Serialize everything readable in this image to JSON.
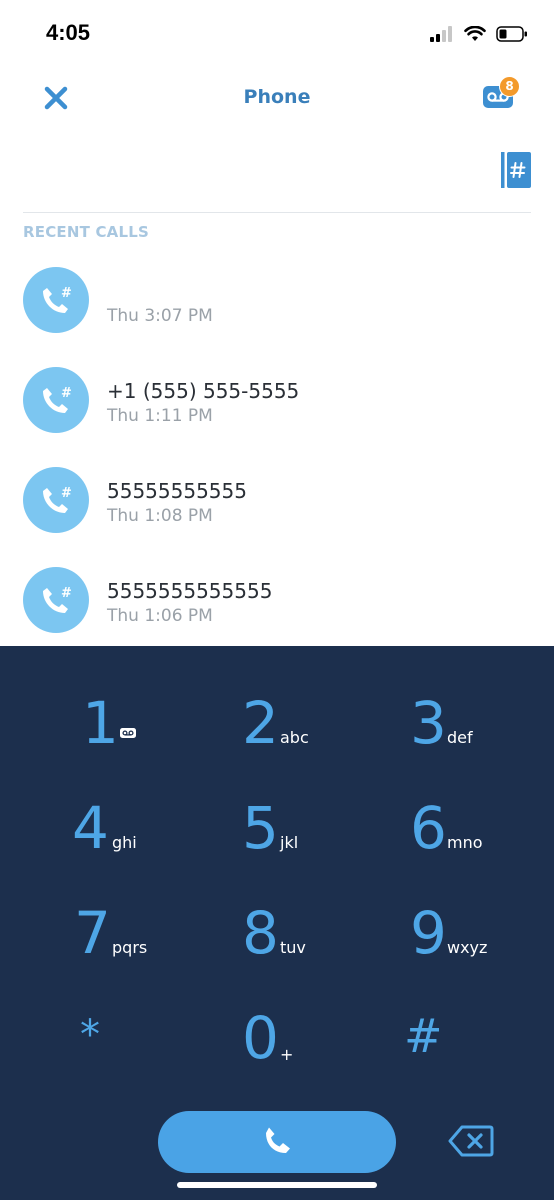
{
  "status_bar": {
    "time": "4:05",
    "icons": [
      "cellular-signal-icon",
      "wifi-icon",
      "battery-icon"
    ]
  },
  "nav": {
    "title": "Phone",
    "close_icon": "close-icon",
    "voicemail_icon": "voicemail-icon",
    "voicemail_badge": "8"
  },
  "search": {
    "dialpad_book_icon": "contacts-dialpad-icon"
  },
  "recent": {
    "header": "RECENT CALLS",
    "calls": [
      {
        "number": "",
        "time": "Thu 3:07 PM"
      },
      {
        "number": "+1 (555) 555-5555",
        "time": "Thu 1:11 PM"
      },
      {
        "number": "55555555555",
        "time": "Thu 1:08 PM"
      },
      {
        "number": "5555555555555",
        "time": "Thu 1:06 PM"
      }
    ]
  },
  "keypad": {
    "keys": [
      {
        "digit": "1",
        "letters": ""
      },
      {
        "digit": "2",
        "letters": "abc"
      },
      {
        "digit": "3",
        "letters": "def"
      },
      {
        "digit": "4",
        "letters": "ghi"
      },
      {
        "digit": "5",
        "letters": "jkl"
      },
      {
        "digit": "6",
        "letters": "mno"
      },
      {
        "digit": "7",
        "letters": "pqrs"
      },
      {
        "digit": "8",
        "letters": "tuv"
      },
      {
        "digit": "9",
        "letters": "wxyz"
      },
      {
        "digit": "*",
        "letters": ""
      },
      {
        "digit": "0",
        "letters": "+"
      },
      {
        "digit": "#",
        "letters": ""
      }
    ],
    "call_icon": "phone-icon",
    "backspace_icon": "backspace-icon"
  },
  "colors": {
    "accent": "#3a7fba",
    "avatar": "#7cc6f1",
    "keypad_bg": "#1c2f4d",
    "digit": "#4ea6e6",
    "call_button": "#4aa3e6",
    "badge": "#f39a2b"
  }
}
